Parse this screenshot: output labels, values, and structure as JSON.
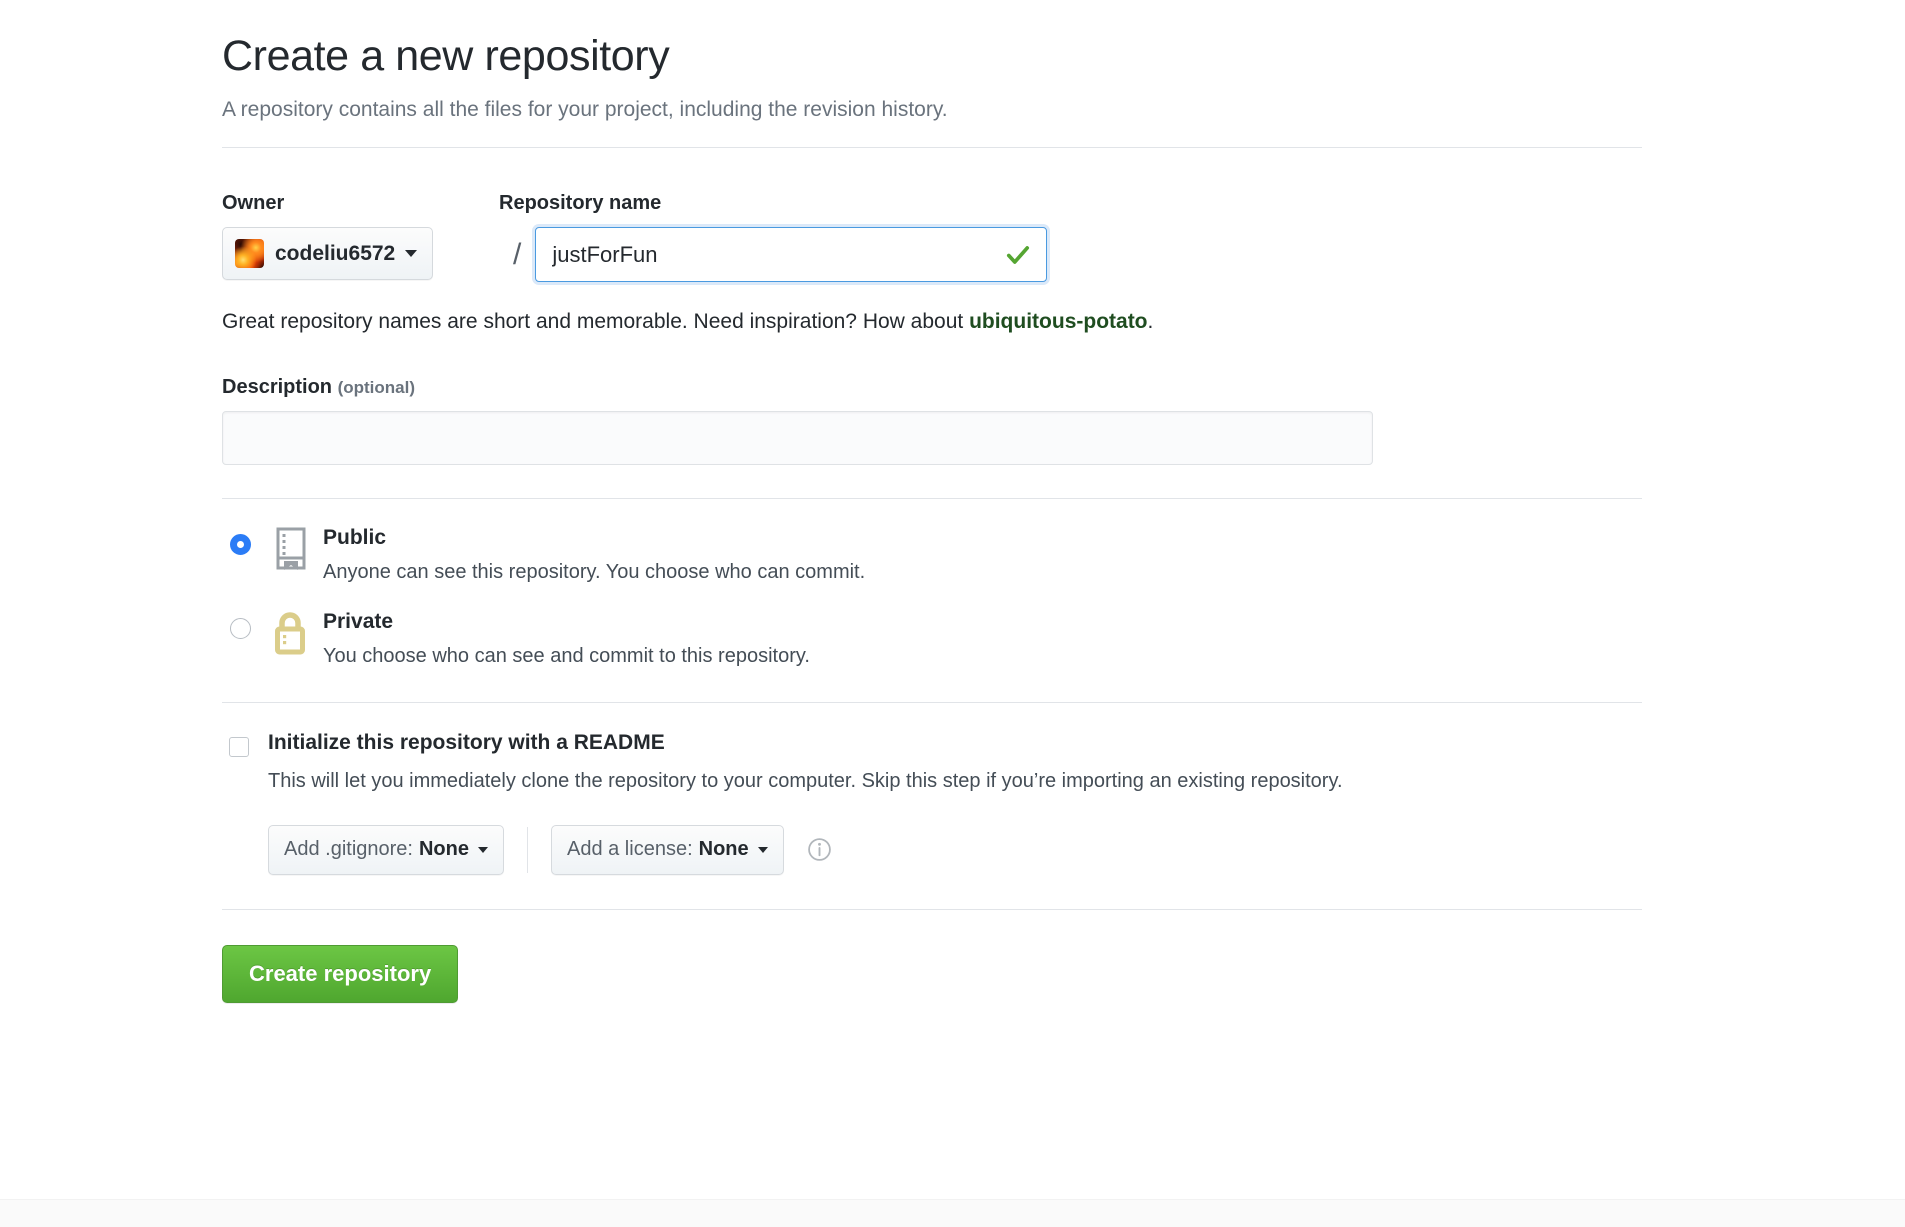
{
  "header": {
    "title": "Create a new repository",
    "subtitle": "A repository contains all the files for your project, including the revision history."
  },
  "owner": {
    "label": "Owner",
    "name": "codeliu6572",
    "avatar_icon": "flame-avatar",
    "caret_icon": "chevron-down-icon",
    "separator": "/"
  },
  "repository_name": {
    "label": "Repository name",
    "value": "justForFun",
    "placeholder": "",
    "valid_icon": "check-icon"
  },
  "hint": {
    "prefix": "Great repository names are short and memorable. Need inspiration? How about ",
    "suggestion": "ubiquitous-potato",
    "suffix": "."
  },
  "description": {
    "label": "Description",
    "optional_label": "(optional)",
    "value": "",
    "placeholder": ""
  },
  "visibility": {
    "options": [
      {
        "id": "public",
        "title": "Public",
        "description": "Anyone can see this repository. You choose who can commit.",
        "icon": "repo-book-icon",
        "selected": true
      },
      {
        "id": "private",
        "title": "Private",
        "description": "You choose who can see and commit to this repository.",
        "icon": "lock-icon",
        "selected": false
      }
    ]
  },
  "readme": {
    "title": "Initialize this repository with a README",
    "description": "This will let you immediately clone the repository to your computer. Skip this step if you’re importing an existing repository.",
    "checked": false
  },
  "gitignore": {
    "label": "Add .gitignore:",
    "value": "None",
    "caret_icon": "chevron-down-icon"
  },
  "license": {
    "label": "Add a license:",
    "value": "None",
    "caret_icon": "chevron-down-icon",
    "info_icon": "info-circle-icon"
  },
  "submit": {
    "label": "Create repository"
  },
  "colors": {
    "accent_green": "#6cc644",
    "link_green": "#1f4d20",
    "radio_blue": "#2b7cf6",
    "check_green": "#55a532",
    "lock_khaki": "#dbcd8a",
    "repo_grey": "#9aa0a6",
    "text": "#24292e",
    "muted": "#6a737d",
    "border": "#e1e4e8"
  }
}
